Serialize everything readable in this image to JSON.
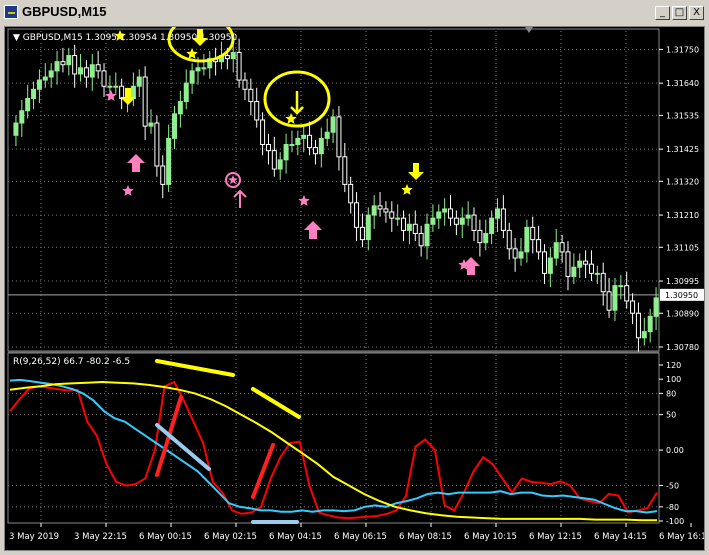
{
  "window": {
    "title": "GBPUSD,M15",
    "buttons": [
      "_",
      "□",
      "X"
    ]
  },
  "main_panel": {
    "header": "▼ GBPUSD,M15  1.3095  1.30954  1.30950  1.30950",
    "current_price": "1.30950",
    "y_ticks": [
      "1.31750",
      "1.31640",
      "1.31535",
      "1.31425",
      "1.31320",
      "1.31210",
      "1.31105",
      "1.30995",
      "1.30890",
      "1.30780"
    ]
  },
  "indicator_panel": {
    "header": "R(9,26,52) 66.7 -80.2 -6.5",
    "y_ticks": [
      "120",
      "100",
      "80",
      "50",
      "0.00",
      "-50",
      "-80",
      "-100"
    ]
  },
  "x_ticks": [
    "3 May 2019",
    "3 May 22:15",
    "6 May 00:15",
    "6 May 02:15",
    "6 May 04:15",
    "6 May 06:15",
    "6 May 08:15",
    "6 May 10:15",
    "6 May 12:15",
    "6 May 14:15",
    "6 May 16:15"
  ],
  "colors": {
    "background": "#000000",
    "grid": "#777777",
    "candle_up": "#90ee90",
    "candle_down": "#ffffff",
    "signal_down_arrow": "#ffff00",
    "signal_up_arrow": "#ff80c0",
    "rsi_fast": "#ff0000",
    "rsi_mid": "#33ccff",
    "rsi_slow": "#ffff00",
    "annotation": "#ffff00"
  },
  "chart_data": [
    {
      "type": "candlestick",
      "symbol": "GBPUSD",
      "timeframe": "M15",
      "ylim": [
        1.3078,
        1.3181
      ],
      "grid": true,
      "close": [
        1.3151,
        1.3155,
        1.3159,
        1.3162,
        1.3165,
        1.3166,
        1.3168,
        1.3171,
        1.317,
        1.3173,
        1.3167,
        1.3169,
        1.3166,
        1.317,
        1.3168,
        1.3163,
        1.3163,
        1.3163,
        1.3159,
        1.3159,
        1.3163,
        1.3166,
        1.315,
        1.3151,
        1.3137,
        1.3131,
        1.3146,
        1.3154,
        1.3158,
        1.3164,
        1.3168,
        1.3169,
        1.3169,
        1.3172,
        1.3171,
        1.3173,
        1.3172,
        1.3174,
        1.3165,
        1.3162,
        1.3158,
        1.3152,
        1.3144,
        1.3142,
        1.3136,
        1.3139,
        1.3144,
        1.3144,
        1.3146,
        1.3147,
        1.3143,
        1.3141,
        1.3146,
        1.3148,
        1.3153,
        1.314,
        1.3131,
        1.3125,
        1.3117,
        1.3113,
        1.3121,
        1.3124,
        1.3123,
        1.3122,
        1.312,
        1.312,
        1.3116,
        1.3118,
        1.3115,
        1.3111,
        1.3118,
        1.312,
        1.3122,
        1.3123,
        1.312,
        1.3118,
        1.312,
        1.3121,
        1.3116,
        1.3112,
        1.3115,
        1.312,
        1.3123,
        1.3116,
        1.311,
        1.3107,
        1.3109,
        1.3117,
        1.3113,
        1.3109,
        1.3102,
        1.3107,
        1.3112,
        1.3109,
        1.3101,
        1.3104,
        1.3106,
        1.3105,
        1.3102,
        1.3102,
        1.3096,
        1.309,
        1.3098,
        1.3098,
        1.3093,
        1.3089,
        1.3081,
        1.3083,
        1.3088,
        1.3094
      ],
      "last_price": 1.3095
    },
    {
      "type": "line",
      "title": "R(9,26,52)",
      "ylim": [
        -100,
        120
      ],
      "series": [
        {
          "name": "R9",
          "values": [
            55,
            72,
            87,
            90,
            88,
            86,
            84,
            85,
            40,
            20,
            -20,
            -45,
            -50,
            -48,
            -40,
            0,
            90,
            96,
            70,
            40,
            10,
            -45,
            -60,
            -85,
            -90,
            -88,
            -80,
            -40,
            -10,
            10,
            12,
            -50,
            -88,
            -92,
            -95,
            -96,
            -95,
            -94,
            -93,
            -90,
            -85,
            -65,
            5,
            15,
            0,
            -78,
            -85,
            -60,
            -30,
            -10,
            -20,
            -40,
            -60,
            -40,
            -45,
            -46,
            -48,
            -44,
            -50,
            -68,
            -72,
            -75,
            -62,
            -64,
            -88,
            -85,
            -82,
            -60
          ],
          "latest": 66.7
        },
        {
          "name": "R26",
          "values": [
            98,
            99,
            97,
            95,
            93,
            90,
            86,
            80,
            70,
            55,
            45,
            40,
            30,
            20,
            10,
            0,
            -10,
            -20,
            -30,
            -45,
            -60,
            -75,
            -80,
            -82,
            -85,
            -85,
            -87,
            -87,
            -85,
            -87,
            -85,
            -85,
            -86,
            -85,
            -80,
            -78,
            -80,
            -75,
            -72,
            -68,
            -62,
            -60,
            -62,
            -60,
            -60,
            -60,
            -60,
            -58,
            -62,
            -60,
            -60,
            -64,
            -65,
            -64,
            -66,
            -68,
            -70,
            -76,
            -82,
            -86,
            -86,
            -88,
            -86
          ],
          "latest": -80.2
        },
        {
          "name": "R52",
          "values": [
            85,
            88,
            90,
            93,
            94,
            95,
            96,
            95,
            94,
            92,
            89,
            85,
            80,
            72,
            62,
            50,
            38,
            25,
            10,
            -5,
            -20,
            -38,
            -50,
            -62,
            -72,
            -80,
            -85,
            -89,
            -92,
            -94,
            -95,
            -96,
            -97,
            -97,
            -97,
            -97,
            -97,
            -97,
            -98,
            -98,
            -98,
            -99,
            -99
          ],
          "latest": -6.5
        }
      ]
    }
  ]
}
